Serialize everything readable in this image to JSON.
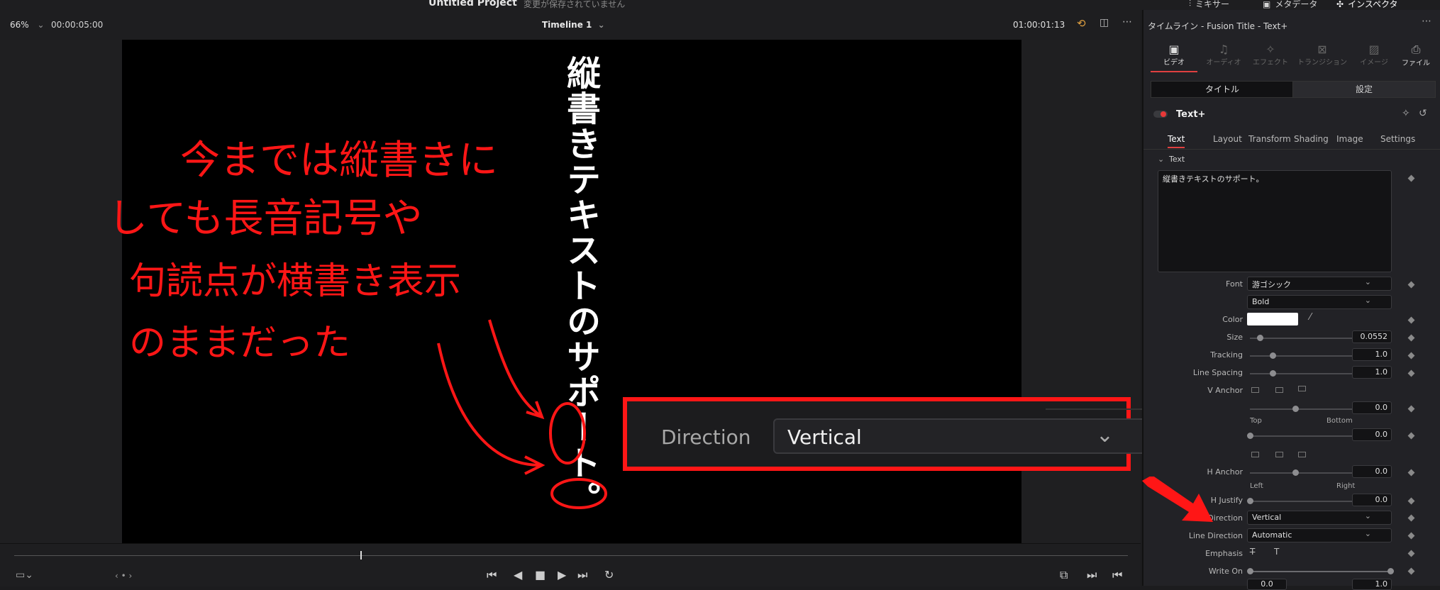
{
  "topbar": {
    "project_title": "Untitled Project",
    "unsaved_note": "変更が保存されていません",
    "nav": [
      {
        "label": "ミキサー",
        "icon": "mixer-icon"
      },
      {
        "label": "メタデータ",
        "icon": "metadata-icon"
      },
      {
        "label": "インスペクタ",
        "icon": "inspector-icon"
      }
    ]
  },
  "viewer": {
    "zoom": "66%",
    "duration": "00:00:05:00",
    "timeline_name": "Timeline 1",
    "timecode": "01:00:01:13"
  },
  "canvas": {
    "vertical_text": "縦書きテキストのサポート。",
    "annotation_lines": [
      "今までは縦書きに",
      "しても長音記号や",
      "句読点が横書き表示",
      "のままだった"
    ],
    "callout": {
      "label": "Direction",
      "value": "Vertical"
    }
  },
  "inspector": {
    "header_title": "タイムライン - Fusion Title - Text+",
    "media_tabs": [
      "ビデオ",
      "オーディオ",
      "エフェクト",
      "トランジション",
      "イメージ",
      "ファイル"
    ],
    "sub_tabs": [
      "タイトル",
      "設定"
    ],
    "node_name": "Text+",
    "param_tabs": [
      "Text",
      "Layout",
      "Transform",
      "Shading",
      "Image",
      "Settings"
    ],
    "section": "Text",
    "text_value": "縦書きテキストのサポート。",
    "font_label": "Font",
    "font_value": "游ゴシック",
    "style_value": "Bold",
    "color_label": "Color",
    "size_label": "Size",
    "size_value": "0.0552",
    "tracking_label": "Tracking",
    "tracking_value": "1.0",
    "line_spacing_label": "Line Spacing",
    "line_spacing_value": "1.0",
    "v_anchor_label": "V Anchor",
    "v_anchor_value": "0.0",
    "v_anchor_top": "Top",
    "v_anchor_bottom": "Bottom",
    "v_justify_value": "0.0",
    "h_anchor_label": "H Anchor",
    "h_anchor_value": "0.0",
    "h_anchor_left": "Left",
    "h_anchor_right": "Right",
    "h_justify_label": "H Justify",
    "h_justify_value": "0.0",
    "direction_label": "Direction",
    "direction_value": "Vertical",
    "line_direction_label": "Line Direction",
    "line_direction_value": "Automatic",
    "emphasis_label": "Emphasis",
    "write_on_label": "Write On",
    "write_on_start": "0.0",
    "write_on_end": "1.0"
  },
  "colors": {
    "accent_red": "#ff1616",
    "text_color_swatch": "#ffffff"
  }
}
